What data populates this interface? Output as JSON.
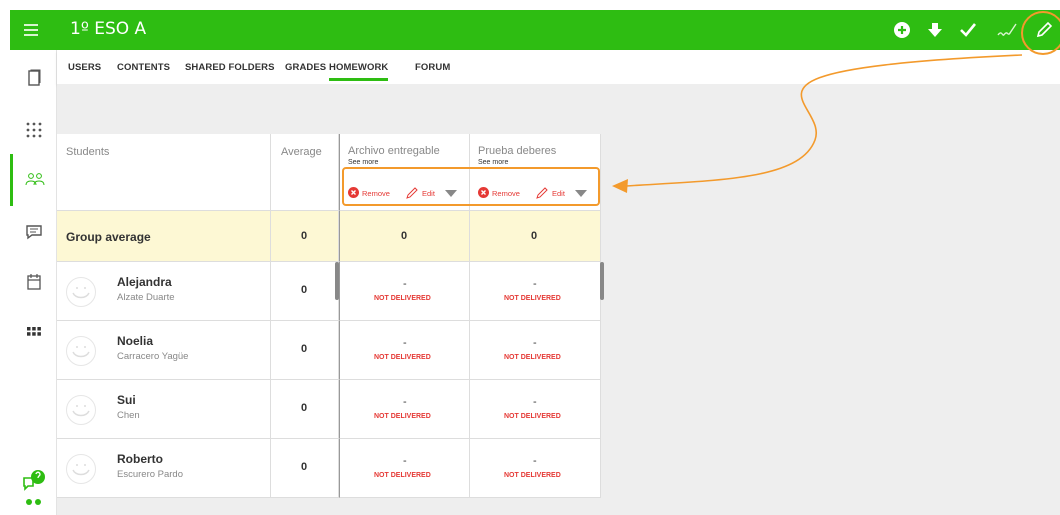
{
  "app": {
    "title": "1º ESO A",
    "accent": "#2ebd12",
    "toolbar_icons": [
      "add-circle-icon",
      "download-icon",
      "check-icon",
      "signature-icon",
      "pencil-icon"
    ],
    "sidebar_icons": [
      "tablet-icon",
      "apps-dots-icon",
      "users-icon",
      "message-icon",
      "calendar-icon",
      "grid-icon",
      "chat-help-icon",
      "dots-icon"
    ]
  },
  "tabs": [
    {
      "label": "USERS"
    },
    {
      "label": "CONTENTS"
    },
    {
      "label": "SHARED FOLDERS"
    },
    {
      "label": "GRADES"
    },
    {
      "label": "HOMEWORK",
      "active": true
    },
    {
      "label": "FORUM"
    }
  ],
  "table": {
    "headers": {
      "students": "Students",
      "average": "Average",
      "assignments": [
        {
          "name": "Archivo entregable",
          "see_more": "See more",
          "remove": "Remove",
          "edit": "Edit"
        },
        {
          "name": "Prueba deberes",
          "see_more": "See more",
          "remove": "Remove",
          "edit": "Edit"
        }
      ]
    },
    "group_average": {
      "label": "Group average",
      "average": "0",
      "scores": [
        "0",
        "0"
      ]
    },
    "students": [
      {
        "first": "Alejandra",
        "last": "Alzate Duarte",
        "average": "0",
        "scores": [
          {
            "value": "-",
            "status": "NOT DELIVERED"
          },
          {
            "value": "-",
            "status": "NOT DELIVERED"
          }
        ]
      },
      {
        "first": "Noelia",
        "last": "Carracero Yagüe",
        "average": "0",
        "scores": [
          {
            "value": "-",
            "status": "NOT DELIVERED"
          },
          {
            "value": "-",
            "status": "NOT DELIVERED"
          }
        ]
      },
      {
        "first": "Sui",
        "last": "Chen",
        "average": "0",
        "scores": [
          {
            "value": "-",
            "status": "NOT DELIVERED"
          },
          {
            "value": "-",
            "status": "NOT DELIVERED"
          }
        ]
      },
      {
        "first": "Roberto",
        "last": "Escurero Pardo",
        "average": "0",
        "scores": [
          {
            "value": "-",
            "status": "NOT DELIVERED"
          },
          {
            "value": "-",
            "status": "NOT DELIVERED"
          }
        ]
      }
    ]
  },
  "annotation": {
    "color": "#f39a2c"
  }
}
